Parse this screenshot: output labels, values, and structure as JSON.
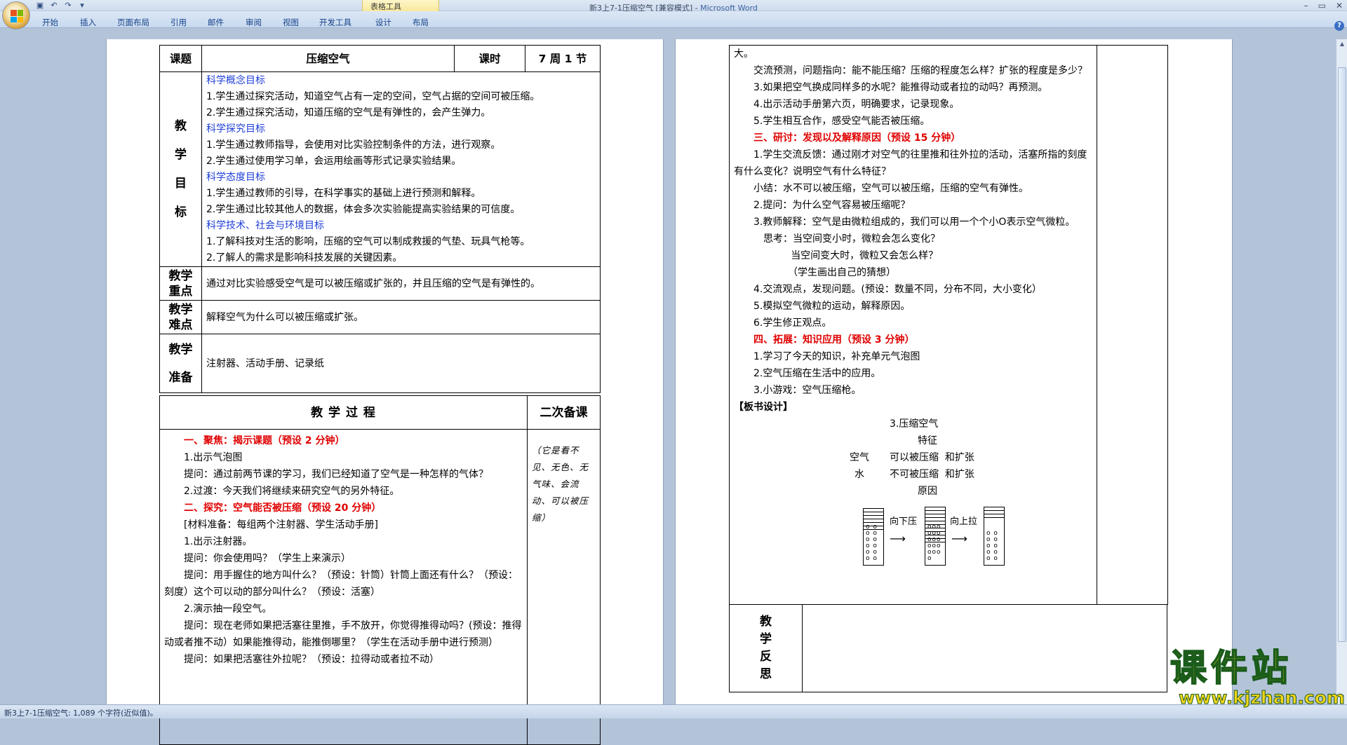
{
  "window": {
    "title": "新3上7-1压缩空气 [兼容模式]",
    "app_name": "Microsoft Word",
    "context_tab_group": "表格工具",
    "controls": [
      "–",
      "▭",
      "✕"
    ]
  },
  "ribbon": {
    "tabs": [
      "开始",
      "插入",
      "页面布局",
      "引用",
      "邮件",
      "审阅",
      "视图",
      "开发工具",
      "设计",
      "布局"
    ]
  },
  "lesson": {
    "topic_label": "课题",
    "topic": "压缩空气",
    "period_label": "课时",
    "period": "7 周 1 节",
    "goals_label": [
      "教",
      "学",
      "目",
      "标"
    ],
    "goals": [
      {
        "heading": "科学概念目标",
        "items": [
          "1.学生通过探究活动，知道空气占有一定的空间，空气占据的空间可被压缩。",
          "2.学生通过探究活动，知道压缩的空气是有弹性的，会产生弹力。"
        ]
      },
      {
        "heading": "科学探究目标",
        "items": [
          "1.学生通过教师指导，会使用对比实验控制条件的方法，进行观察。",
          "2.学生通过使用学习单，会运用绘画等形式记录实验结果。"
        ]
      },
      {
        "heading": "科学态度目标",
        "items": [
          "1.学生通过教师的引导，在科学事实的基础上进行预测和解释。",
          "2.学生通过比较其他人的数据，体会多次实验能提高实验结果的可信度。"
        ]
      },
      {
        "heading": "科学技术、社会与环境目标",
        "items": [
          "1.了解科技对生活的影响，压缩的空气可以制成救援的气垫、玩具气枪等。",
          "2.了解人的需求是影响科技发展的关键因素。"
        ]
      }
    ],
    "key_label": [
      "教学",
      "重点"
    ],
    "key_point": "通过对比实验感受空气是可以被压缩或扩张的，并且压缩的空气是有弹性的。",
    "difficulty_label": [
      "教学",
      "难点"
    ],
    "difficulty": "解释空气为什么可以被压缩或扩张。",
    "prep_label": [
      "教学",
      "准备"
    ],
    "prep": "注射器、活动手册、记录纸",
    "process_header": "教 学 过 程",
    "second_prep_header": "二次备课",
    "second_prep_note": "（它是看不见、无色、无气味、会流动、可以被压缩）",
    "process_page1": [
      {
        "t": "一、聚焦：揭示课题（预设 2 分钟）",
        "s": "red"
      },
      {
        "t": "1.出示气泡图",
        "s": "ind"
      },
      {
        "t": "提问：通过前两节课的学习，我们已经知道了空气是一种怎样的气体？",
        "s": "ind"
      },
      {
        "t": "2.过渡：今天我们将继续来研究空气的另外特征。",
        "s": "ind"
      },
      {
        "t": "二、探究：空气能否被压缩（预设 20 分钟）",
        "s": "red"
      },
      {
        "t": "[材料准备：每组两个注射器、学生活动手册]",
        "s": "ind"
      },
      {
        "t": "1.出示注射器。",
        "s": "ind"
      },
      {
        "t": "提问：你会使用吗？（学生上来演示）",
        "s": "ind"
      },
      {
        "t": "提问：用手握住的地方叫什么？（预设：针筒）针筒上面还有什么？（预设：刻度）这个可以动的部分叫什么？（预设：活塞）",
        "s": "ind"
      },
      {
        "t": "2.演示抽一段空气。",
        "s": "ind"
      },
      {
        "t": "提问：现在老师如果把活塞往里推，手不放开，你觉得推得动吗？(预设：推得动或者推不动）如果能推得动，能推倒哪里？（学生在活动手册中进行预测）",
        "s": "ind"
      },
      {
        "t": "提问：如果把活塞往外拉呢？（预设：拉得动或者拉不动）",
        "s": "ind"
      }
    ],
    "process_page2": [
      {
        "t": "大。",
        "s": ""
      },
      {
        "t": "交流预测，问题指向：能不能压缩？压缩的程度怎么样？扩张的程度是多少？",
        "s": "ind"
      },
      {
        "t": "3.如果把空气换成同样多的水呢？能推得动或者拉的动吗？再预测。",
        "s": "ind"
      },
      {
        "t": "4.出示活动手册第六页，明确要求，记录现象。",
        "s": "ind"
      },
      {
        "t": "5.学生相互合作，感受空气能否被压缩。",
        "s": "ind"
      },
      {
        "t": "三、研讨：发现以及解释原因（预设 15 分钟）",
        "s": "red"
      },
      {
        "t": "1.学生交流反馈：通过刚才对空气的往里推和往外拉的活动，活塞所指的刻度有什么变化？说明空气有什么特征？",
        "s": "ind"
      },
      {
        "t": "小结：水不可以被压缩，空气可以被压缩，压缩的空气有弹性。",
        "s": "ind"
      },
      {
        "t": "2.提问：为什么空气容易被压缩呢？",
        "s": "ind"
      },
      {
        "t": "3.教师解释：空气是由微粒组成的，我们可以用一个个小O表示空气微粒。",
        "s": "ind"
      },
      {
        "t": "思考：当空间变小时，微粒会怎么变化？",
        "s": "ind3"
      },
      {
        "t": "当空间变大时，微粒又会怎么样？",
        "s": "ind6"
      },
      {
        "t": "（学生画出自己的猜想）",
        "s": "ind5"
      },
      {
        "t": "4.交流观点，发现问题。(预设：数量不同，分布不同，大小变化）",
        "s": "ind"
      },
      {
        "t": "5.模拟空气微粒的运动，解释原因。",
        "s": "ind"
      },
      {
        "t": "6.学生修正观点。",
        "s": "ind"
      },
      {
        "t": "四、拓展：知识应用（预设 3 分钟）",
        "s": "red"
      },
      {
        "t": "1.学习了今天的知识，补充单元气泡图",
        "s": "ind"
      },
      {
        "t": "2.空气压缩在生活中的应用。",
        "s": "ind"
      },
      {
        "t": "3.小游戏：空气压缩枪。",
        "s": "ind"
      }
    ],
    "board_label": "【板书设计】",
    "board": {
      "title": "3.压缩空气",
      "feature": "特征",
      "air_label": "空气",
      "air_text": "可以被压缩  和扩张",
      "water_label": "水",
      "water_text": "不可被压缩  和扩张",
      "reason": "原因",
      "push_down": "向下压",
      "pull_up": "向上拉"
    },
    "reflection_label": [
      "教",
      "学",
      "反",
      "思"
    ]
  },
  "status": {
    "text": "新3上7-1压缩空气: 1,089 个字符(近似值)。"
  },
  "watermark": {
    "text": "课件站",
    "url": "www.kjzhan.com"
  }
}
